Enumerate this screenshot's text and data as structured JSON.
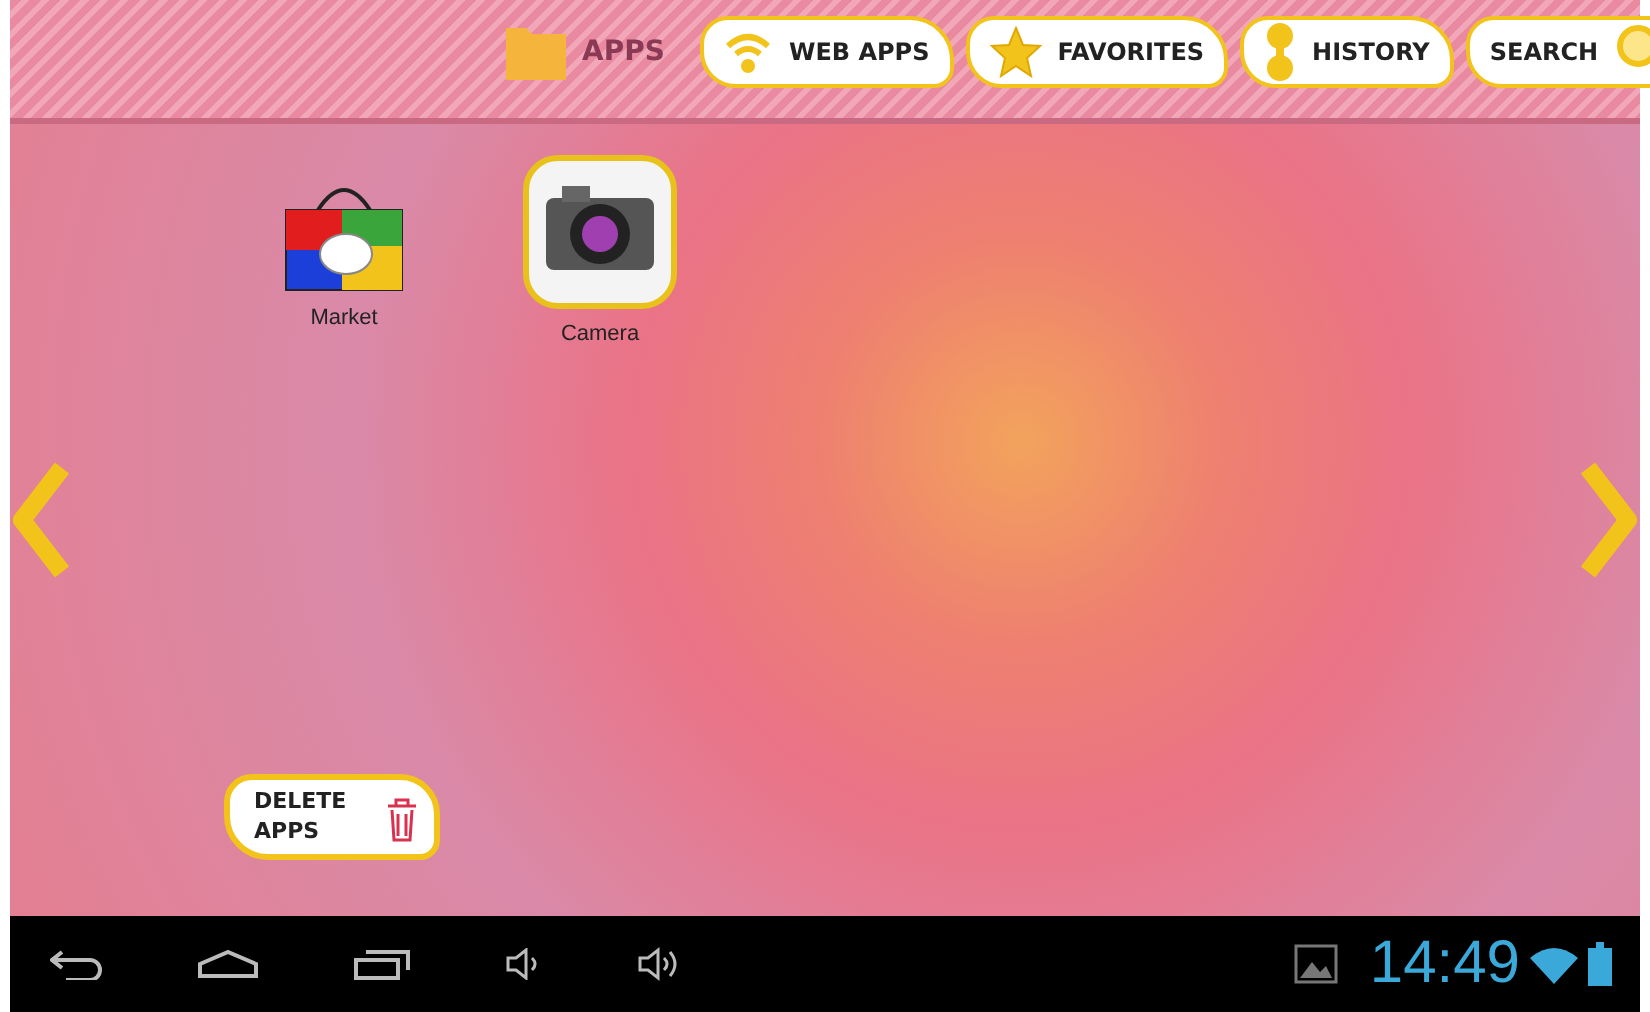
{
  "tabs": [
    {
      "label": "APPS",
      "selected": true
    },
    {
      "label": "WEB APPS",
      "selected": false
    },
    {
      "label": "FAVORITES",
      "selected": false
    },
    {
      "label": "HISTORY",
      "selected": false
    },
    {
      "label": "SEARCH",
      "selected": false
    }
  ],
  "apps": [
    {
      "label": "Market"
    },
    {
      "label": "Camera"
    }
  ],
  "delete_button": {
    "label": "DELETE APPS"
  },
  "status_bar": {
    "time": "14:49"
  }
}
